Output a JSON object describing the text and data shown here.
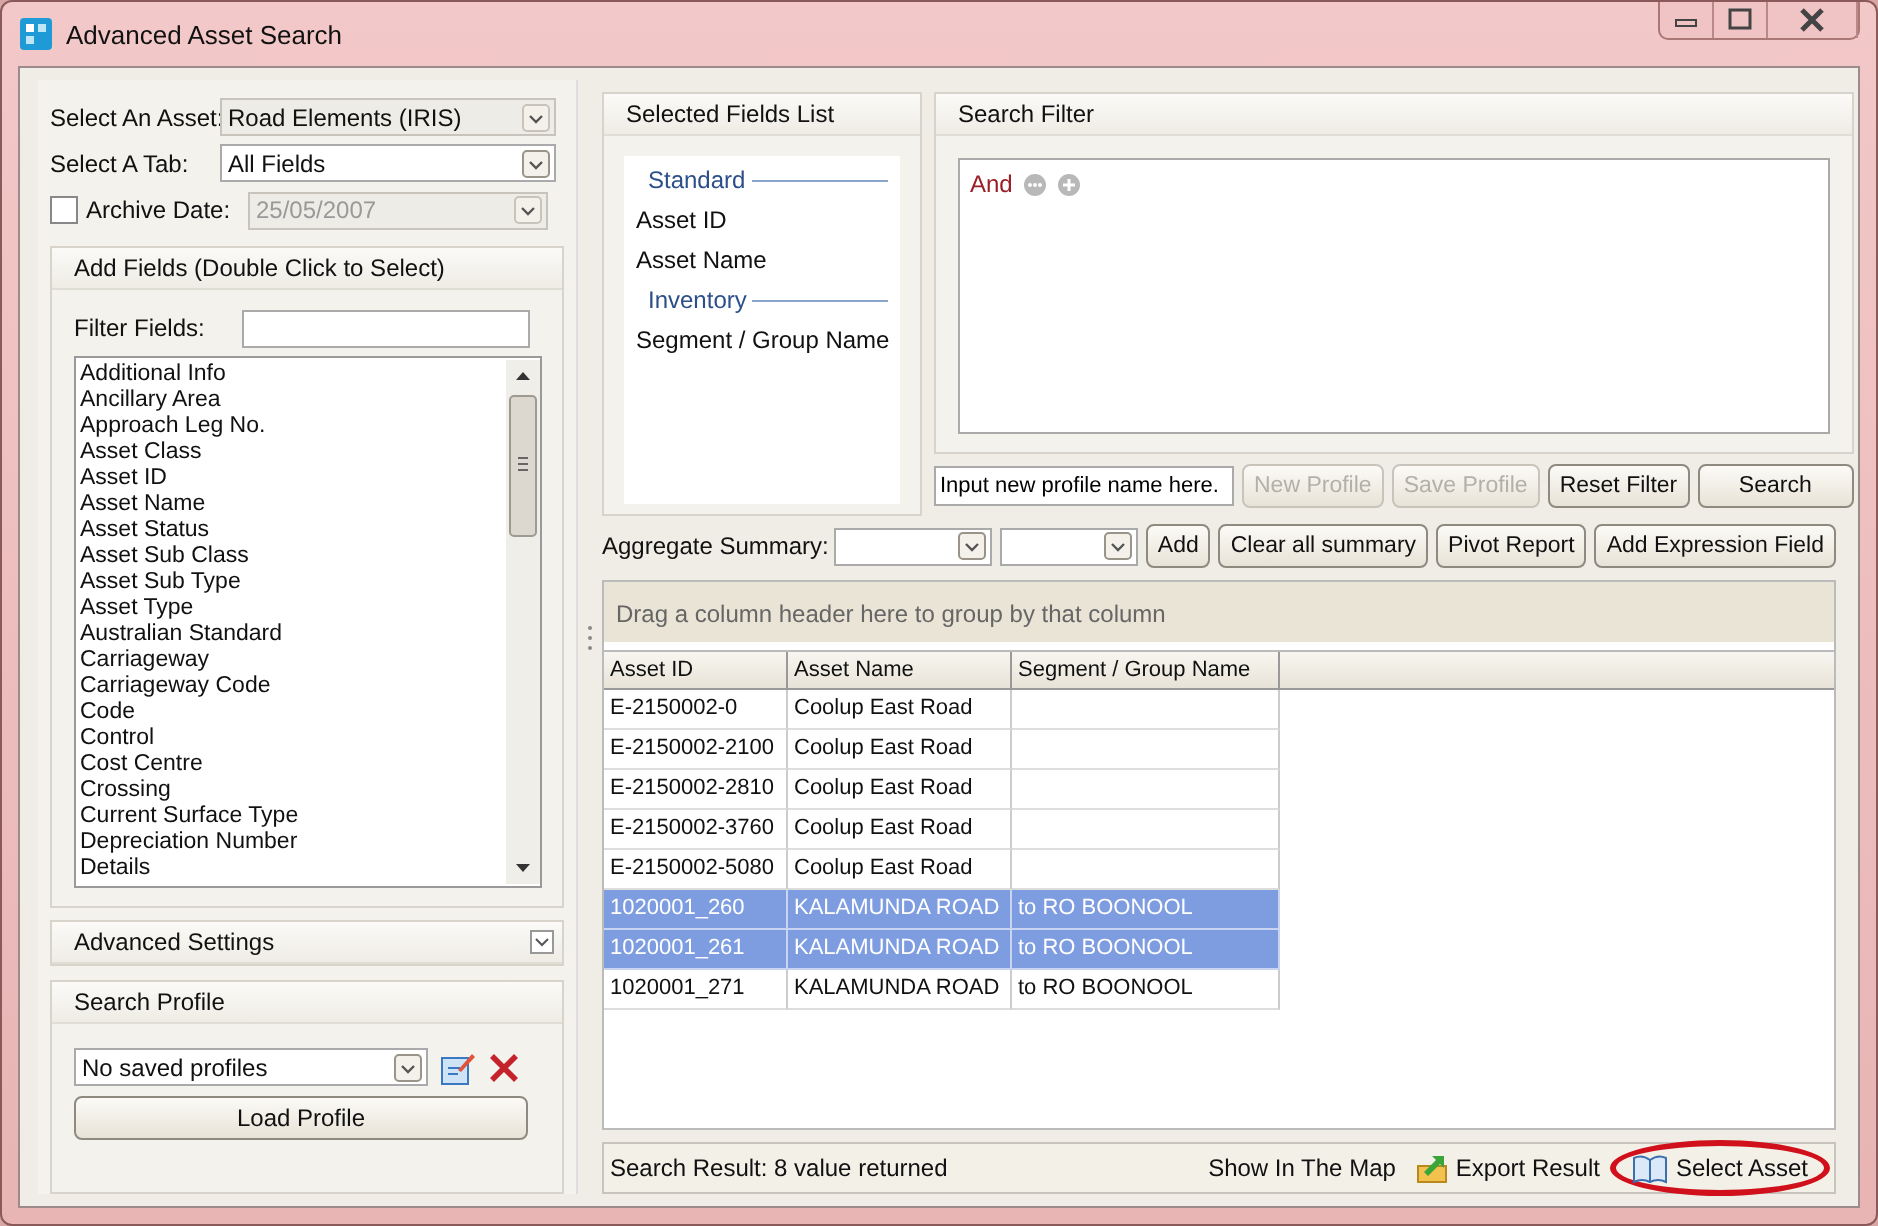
{
  "window": {
    "title": "Advanced Asset Search"
  },
  "asset_select": {
    "label": "Select An Asset:",
    "value": "Road Elements (IRIS)",
    "disabled": true
  },
  "tab_select": {
    "label": "Select A Tab:",
    "value": "All Fields",
    "disabled": false
  },
  "archive_date": {
    "label": "Archive Date:",
    "checked": false,
    "value": "25/05/2007",
    "disabled": true
  },
  "add_fields": {
    "title": "Add Fields (Double Click to Select)",
    "filter_label": "Filter Fields:",
    "items": [
      "Additional Info",
      "Ancillary Area",
      "Approach Leg No.",
      "Asset Class",
      "Asset ID",
      "Asset Name",
      "Asset Status",
      "Asset Sub Class",
      "Asset Sub Type",
      "Asset Type",
      "Australian Standard",
      "Carriageway",
      "Carriageway Code",
      "Code",
      "Control",
      "Cost Centre",
      "Crossing",
      "Current Surface Type",
      "Depreciation Number",
      "Details"
    ]
  },
  "advanced_settings": {
    "title": "Advanced Settings",
    "expanded": false
  },
  "search_profile": {
    "title": "Search Profile",
    "value": "No saved profiles",
    "button": "Load Profile"
  },
  "selected_fields": {
    "title": "Selected Fields List",
    "groups": [
      {
        "name": "Standard",
        "fields": [
          "Asset ID",
          "Asset Name"
        ]
      },
      {
        "name": "Inventory",
        "fields": [
          "Segment / Group Name"
        ]
      }
    ]
  },
  "search_filter": {
    "title": "Search Filter",
    "operator": "And"
  },
  "profile_name": {
    "value": "Input new profile name here."
  },
  "profile_buttons": [
    {
      "label": "New Profile",
      "disabled": true
    },
    {
      "label": "Save Profile",
      "disabled": true
    },
    {
      "label": "Reset Filter",
      "disabled": false
    },
    {
      "label": "Search",
      "disabled": false
    }
  ],
  "aggregate": {
    "label": "Aggregate Summary:",
    "buttons": [
      "Add",
      "Clear all summary",
      "Pivot Report",
      "Add Expression Field"
    ]
  },
  "grid": {
    "group_hint": "Drag a column header here to group by that column",
    "columns": [
      "Asset ID",
      "Asset Name",
      "Segment / Group Name"
    ],
    "rows": [
      {
        "cells": [
          "E-2150002-0",
          "Coolup East Road",
          ""
        ],
        "selected": false
      },
      {
        "cells": [
          "E-2150002-2100",
          "Coolup East Road",
          ""
        ],
        "selected": false
      },
      {
        "cells": [
          "E-2150002-2810",
          "Coolup East Road",
          ""
        ],
        "selected": false
      },
      {
        "cells": [
          "E-2150002-3760",
          "Coolup East Road",
          ""
        ],
        "selected": false
      },
      {
        "cells": [
          "E-2150002-5080",
          "Coolup East Road",
          ""
        ],
        "selected": false
      },
      {
        "cells": [
          "1020001_260",
          "KALAMUNDA ROAD",
          "to RO BOONOOL"
        ],
        "selected": true
      },
      {
        "cells": [
          "1020001_261",
          "KALAMUNDA ROAD",
          "to RO BOONOOL"
        ],
        "selected": true
      },
      {
        "cells": [
          "1020001_271",
          "KALAMUNDA ROAD",
          "to RO BOONOOL"
        ],
        "selected": false
      }
    ]
  },
  "status_bar": {
    "result": "Search Result: 8 value returned",
    "actions": [
      {
        "label": "Show In The Map",
        "kind": "plain",
        "highlighted": false
      },
      {
        "label": "Export Result",
        "kind": "export",
        "highlighted": false
      },
      {
        "label": "Select Asset",
        "kind": "book",
        "highlighted": true
      }
    ]
  }
}
